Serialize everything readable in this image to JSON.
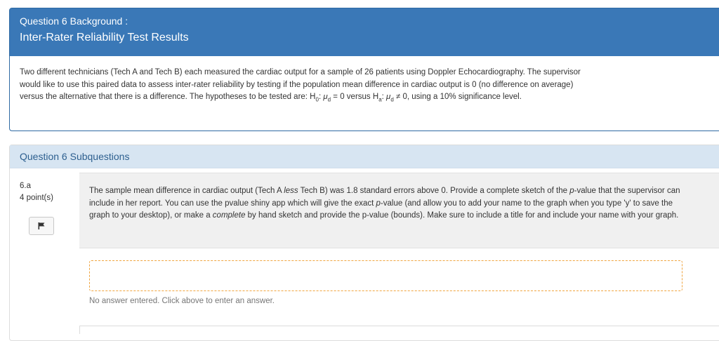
{
  "background": {
    "label": "Question 6 Background :",
    "title": "Inter-Rater Reliability Test Results",
    "text_1": "Two different technicians (Tech A and Tech B) each measured the cardiac output for a sample of 26 patients using Doppler Echocardiography. The supervisor would like to use this paired data to assess inter-rater reliability by testing if the population mean difference in cardiac output is 0 (no difference on average) versus the alternative that there is a difference. The hypotheses to be tested are:  H",
    "h0_sub": "0",
    "h0_mid": ": ",
    "mu": "μ",
    "d_sub": "d",
    "h0_rest": " = 0 versus H",
    "ha_sub": "a",
    "ha_mid": ": ",
    "ha_rest": " ≠ 0, using a 10% significance level."
  },
  "subquestions": {
    "header": "Question 6 Subquestions",
    "number": "6.a",
    "points": "4 point(s)",
    "prompt_1": "The sample mean difference in cardiac output (Tech A ",
    "prompt_less": "less",
    "prompt_2": " Tech B) was 1.8 standard errors above 0.  Provide a complete sketch of the ",
    "prompt_p1": "p",
    "prompt_3": "-value that the supervisor can include in her report.  You can use the pvalue shiny app which will give the exact ",
    "prompt_p2": "p",
    "prompt_4": "-value (and allow you to add your name to the graph when you type 'y' to save the graph to your desktop), or make a ",
    "prompt_complete": "complete",
    "prompt_5": " by hand sketch and provide the p-value (bounds). Make sure to include a title for and include your name with your graph.",
    "no_answer": "No answer entered. Click above to enter an answer."
  },
  "icons": {
    "flag": "flag-icon"
  },
  "colors": {
    "header_blue": "#3a78b7",
    "sub_header_bg": "#d7e5f2",
    "answer_border": "#f0a540"
  }
}
